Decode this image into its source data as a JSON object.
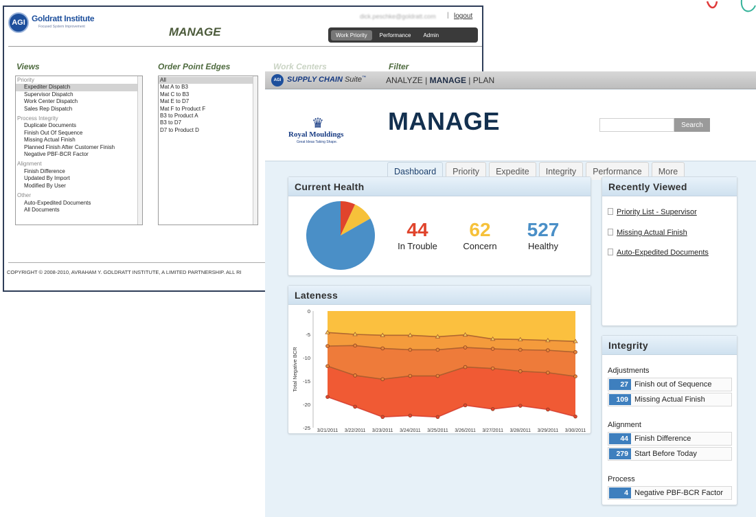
{
  "old_window": {
    "logo_text": "AGI",
    "brand": "Goldratt Institute",
    "brand_sub": "Focused System Improvement",
    "email": "dick.peschke@goldratt.com",
    "separator": "|",
    "logout": "logout",
    "title": "MANAGE",
    "tabs": [
      "Work Priority",
      "Performance",
      "Admin"
    ],
    "active_tab": "Work Priority",
    "columns": {
      "views": "Views",
      "order_point_edges": "Order Point Edges",
      "work_centers": "Work Centers",
      "filter": "Filter"
    },
    "views_list": {
      "priority": {
        "heading": "Priority",
        "items": [
          "Expediter Dispatch",
          "Supervisor Dispatch",
          "Work Center Dispatch",
          "Sales Rep Dispatch"
        ]
      },
      "process_integrity": {
        "heading": "Process Integrity",
        "items": [
          "Duplicate Documents",
          "Finish Out Of Sequence",
          "Missing Actual Finish",
          "Planned Finish After Customer Finish",
          "Negative PBF-BCR Factor"
        ]
      },
      "alignment": {
        "heading": "Alignment",
        "items": [
          "Finish Difference",
          "Updated By Import",
          "Modified By User"
        ]
      },
      "other": {
        "heading": "Other",
        "items": [
          "Auto-Expedited Documents",
          "All Documents"
        ]
      }
    },
    "order_point_edges_list": [
      "All",
      "Mat A to B3",
      "Mat C to B3",
      "Mat E to D7",
      "Mat F to Product F",
      "B3 to Product A",
      "B3 to D7",
      "D7 to Product D"
    ],
    "footer": "COPYRIGHT © 2008-2010, AVRAHAM Y. GOLDRATT INSTITUTE, A LIMITED PARTNERSHIP. ALL RI"
  },
  "new_window": {
    "topbar": {
      "logo_text": "AGI",
      "suite_bold": "SUPPLY CHAIN",
      "suite_rest": "Suite",
      "suite_tm": "™",
      "nav": [
        "ANALYZE",
        "MANAGE",
        "PLAN"
      ],
      "nav_sep": "|"
    },
    "company": {
      "crown": "♛",
      "name": "Royal Mouldings",
      "tagline": "Great Ideas Taking Shape."
    },
    "title": "MANAGE",
    "search": {
      "value": "",
      "button": "Search"
    },
    "tabs": [
      "Dashboard",
      "Priority",
      "Expedite",
      "Integrity",
      "Performance",
      "More"
    ],
    "active_tab": "Dashboard",
    "current_health": {
      "title": "Current Health",
      "stats": [
        {
          "value": "44",
          "label": "In Trouble",
          "color": "#e0442c"
        },
        {
          "value": "62",
          "label": "Concern",
          "color": "#f6c13a"
        },
        {
          "value": "527",
          "label": "Healthy",
          "color": "#4a8fc7"
        }
      ]
    },
    "lateness": {
      "title": "Lateness"
    },
    "recently_viewed": {
      "title": "Recently Viewed",
      "items": [
        "Priority List - Supervisor",
        "Missing Actual Finish",
        "Auto-Expedited Documents"
      ]
    },
    "integrity": {
      "title": "Integrity",
      "sections": [
        {
          "heading": "Adjustments",
          "rows": [
            {
              "count": "27",
              "label": "Finish out of Sequence"
            },
            {
              "count": "109",
              "label": "Missing Actual Finish"
            }
          ]
        },
        {
          "heading": "Alignment",
          "rows": [
            {
              "count": "44",
              "label": "Finish Difference"
            },
            {
              "count": "279",
              "label": "Start Before Today"
            }
          ]
        },
        {
          "heading": "Process",
          "rows": [
            {
              "count": "4",
              "label": "Negative PBF-BCR Factor"
            }
          ]
        }
      ]
    }
  },
  "chart_data": [
    {
      "type": "pie",
      "title": "",
      "slices": [
        {
          "label": "In Trouble",
          "value": 44,
          "color": "#e0442c"
        },
        {
          "label": "Concern",
          "value": 62,
          "color": "#f6c13a"
        },
        {
          "label": "Healthy",
          "value": 527,
          "color": "#4a8fc7"
        }
      ]
    },
    {
      "type": "area",
      "title": "Lateness",
      "xlabel": "",
      "ylabel": "Total Negative BCR",
      "ylim": [
        -25,
        0
      ],
      "yticks": [
        0,
        -5,
        -10,
        -15,
        -20,
        -25
      ],
      "categories": [
        "3/21/2011",
        "3/22/2011",
        "3/23/2011",
        "3/24/2011",
        "3/25/2011",
        "3/26/2011",
        "3/27/2011",
        "3/28/2011",
        "3/29/2011",
        "3/30/2011"
      ],
      "series": [
        {
          "values": [
            -4.6,
            -5.0,
            -5.2,
            -5.2,
            -5.5,
            -5.1,
            -6.0,
            -6.1,
            -6.3,
            -6.5
          ],
          "color": "#f6b93b",
          "marker": "triangle"
        },
        {
          "values": [
            -7.5,
            -7.4,
            -8.0,
            -8.3,
            -8.3,
            -7.8,
            -8.1,
            -8.3,
            -8.4,
            -8.8
          ],
          "color": "#ed8a35",
          "marker": "circle"
        },
        {
          "values": [
            -11.8,
            -13.8,
            -14.6,
            -13.9,
            -13.9,
            -12.0,
            -12.3,
            -12.9,
            -13.2,
            -14.0
          ],
          "color": "#e8703a",
          "marker": "circle"
        },
        {
          "values": [
            -18.4,
            -20.5,
            -22.7,
            -22.4,
            -22.7,
            -20.2,
            -21.0,
            -20.3,
            -21.1,
            -22.6
          ],
          "color": "#ef4e37",
          "marker": "circle"
        }
      ],
      "grid": false
    }
  ]
}
